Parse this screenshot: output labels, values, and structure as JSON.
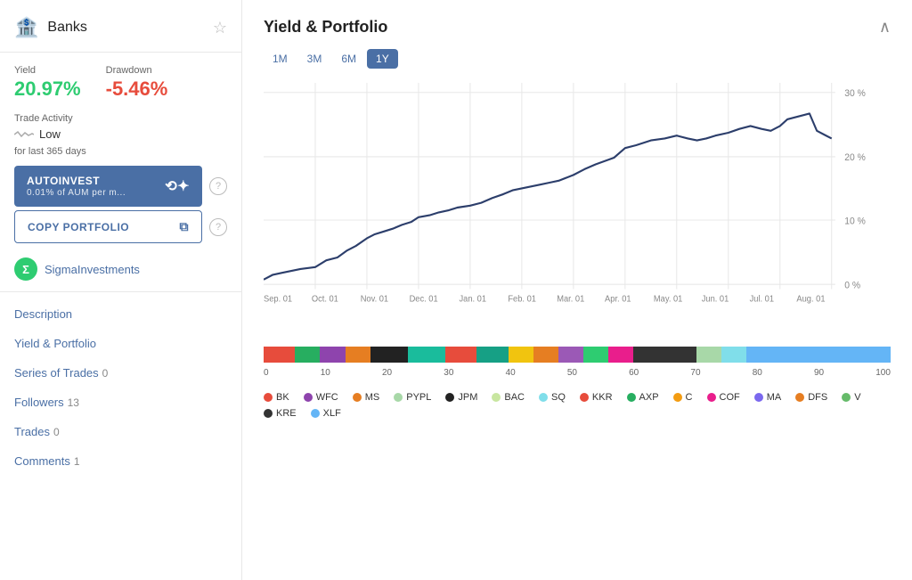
{
  "sidebar": {
    "title": "Banks",
    "yield_label": "Yield",
    "yield_value": "20.97%",
    "drawdown_label": "Drawdown",
    "drawdown_value": "-5.46%",
    "trade_activity_label": "Trade Activity",
    "trade_activity_value": "Low",
    "for_last": "for last 365 days",
    "autoinvest_label": "AUTOINVEST",
    "autoinvest_sub": "0.01% of AUM per m...",
    "copy_portfolio_label": "COPY PORTFOLIO",
    "sigma_name": "SigmaInvestments",
    "nav_items": [
      {
        "label": "Description",
        "badge": ""
      },
      {
        "label": "Yield & Portfolio",
        "badge": ""
      },
      {
        "label": "Series of Trades",
        "badge": "0"
      },
      {
        "label": "Followers",
        "badge": "13"
      },
      {
        "label": "Trades",
        "badge": "0"
      },
      {
        "label": "Comments",
        "badge": "1"
      }
    ]
  },
  "main": {
    "section_title": "Yield & Portfolio",
    "time_tabs": [
      "1M",
      "3M",
      "6M",
      "1Y"
    ],
    "active_tab": "1Y",
    "x_labels": [
      "Sep. 01",
      "Oct. 01",
      "Nov. 01",
      "Dec. 01",
      "Jan. 01",
      "Feb. 01",
      "Mar. 01",
      "Apr. 01",
      "May. 01",
      "Jun. 01",
      "Jul. 01",
      "Aug. 01"
    ],
    "y_labels": [
      "30 %",
      "20 %",
      "10 %",
      "0 %"
    ],
    "bar_axis": [
      "0",
      "10",
      "20",
      "30",
      "40",
      "50",
      "60",
      "70",
      "80",
      "90",
      "100"
    ],
    "legend": [
      {
        "symbol": "BK",
        "color": "#e74c3c"
      },
      {
        "symbol": "AXP",
        "color": "#27ae60"
      },
      {
        "symbol": "WFC",
        "color": "#8e44ad"
      },
      {
        "symbol": "C",
        "color": "#f39c12"
      },
      {
        "symbol": "MS",
        "color": "#e67e22"
      },
      {
        "symbol": "COF",
        "color": "#e91e8c"
      },
      {
        "symbol": "PYPL",
        "color": "#a8d8a8"
      },
      {
        "symbol": "MA",
        "color": "#7b68ee"
      },
      {
        "symbol": "JPM",
        "color": "#222"
      },
      {
        "symbol": "DFS",
        "color": "#e67e22"
      },
      {
        "symbol": "BAC",
        "color": "#c8e6a0"
      },
      {
        "symbol": "V",
        "color": "#66bb6a"
      },
      {
        "symbol": "SQ",
        "color": "#80deea"
      },
      {
        "symbol": "KRE",
        "color": "#222"
      },
      {
        "symbol": "KKR",
        "color": "#e74c3c"
      },
      {
        "symbol": "XLF",
        "color": "#64b5f6"
      }
    ]
  }
}
